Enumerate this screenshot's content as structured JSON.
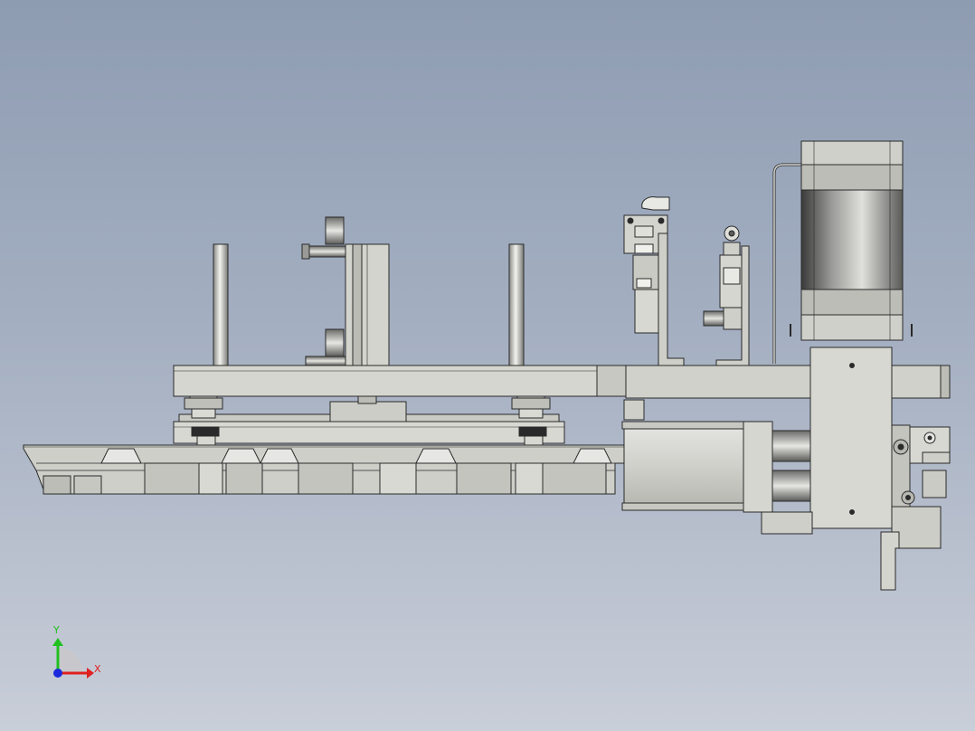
{
  "view": {
    "background_top": "#8e9cb2",
    "background_bottom": "#c9ced8",
    "part_fill": "#d3d3cd",
    "part_shade": "#b8b8b2",
    "edge_color": "#2a2a2a"
  },
  "triad": {
    "x_label": "X",
    "y_label": "Y",
    "x_color": "#e02020",
    "y_color": "#20c020",
    "origin_color": "#1a2adc"
  }
}
